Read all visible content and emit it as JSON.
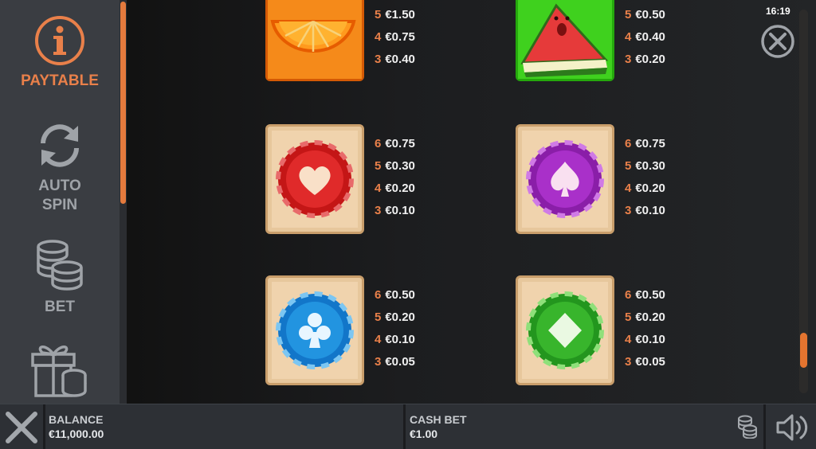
{
  "sidebar": {
    "items": [
      {
        "label": "PAYTABLE",
        "active": true
      },
      {
        "label": "AUTO",
        "label2": "SPIN"
      },
      {
        "label": "BET"
      }
    ]
  },
  "status": {
    "clock": "16:19"
  },
  "paytable": {
    "rows": [
      {
        "left": {
          "symbol": "orange-slice-icon",
          "pays": [
            {
              "count": "5",
              "amount": "€1.50"
            },
            {
              "count": "4",
              "amount": "€0.75"
            },
            {
              "count": "3",
              "amount": "€0.40"
            }
          ]
        },
        "right": {
          "symbol": "watermelon-icon",
          "pays": [
            {
              "count": "5",
              "amount": "€0.50"
            },
            {
              "count": "4",
              "amount": "€0.40"
            },
            {
              "count": "3",
              "amount": "€0.20"
            }
          ]
        }
      },
      {
        "left": {
          "symbol": "heart-chip-icon",
          "pays": [
            {
              "count": "6",
              "amount": "€0.75"
            },
            {
              "count": "5",
              "amount": "€0.30"
            },
            {
              "count": "4",
              "amount": "€0.20"
            },
            {
              "count": "3",
              "amount": "€0.10"
            }
          ]
        },
        "right": {
          "symbol": "spade-chip-icon",
          "pays": [
            {
              "count": "6",
              "amount": "€0.75"
            },
            {
              "count": "5",
              "amount": "€0.30"
            },
            {
              "count": "4",
              "amount": "€0.20"
            },
            {
              "count": "3",
              "amount": "€0.10"
            }
          ]
        }
      },
      {
        "left": {
          "symbol": "club-chip-icon",
          "pays": [
            {
              "count": "6",
              "amount": "€0.50"
            },
            {
              "count": "5",
              "amount": "€0.20"
            },
            {
              "count": "4",
              "amount": "€0.10"
            },
            {
              "count": "3",
              "amount": "€0.05"
            }
          ]
        },
        "right": {
          "symbol": "diamond-chip-icon",
          "pays": [
            {
              "count": "6",
              "amount": "€0.50"
            },
            {
              "count": "5",
              "amount": "€0.20"
            },
            {
              "count": "4",
              "amount": "€0.10"
            },
            {
              "count": "3",
              "amount": "€0.05"
            }
          ]
        }
      }
    ]
  },
  "bottom": {
    "balance_label": "BALANCE",
    "balance_value": "€11,000.00",
    "cashbet_label": "CASH BET",
    "cashbet_value": "€1.00"
  },
  "colors": {
    "accent": "#e9804a",
    "sidebar_bg": "#3a3d42",
    "bottom_bg": "#2d3035"
  }
}
